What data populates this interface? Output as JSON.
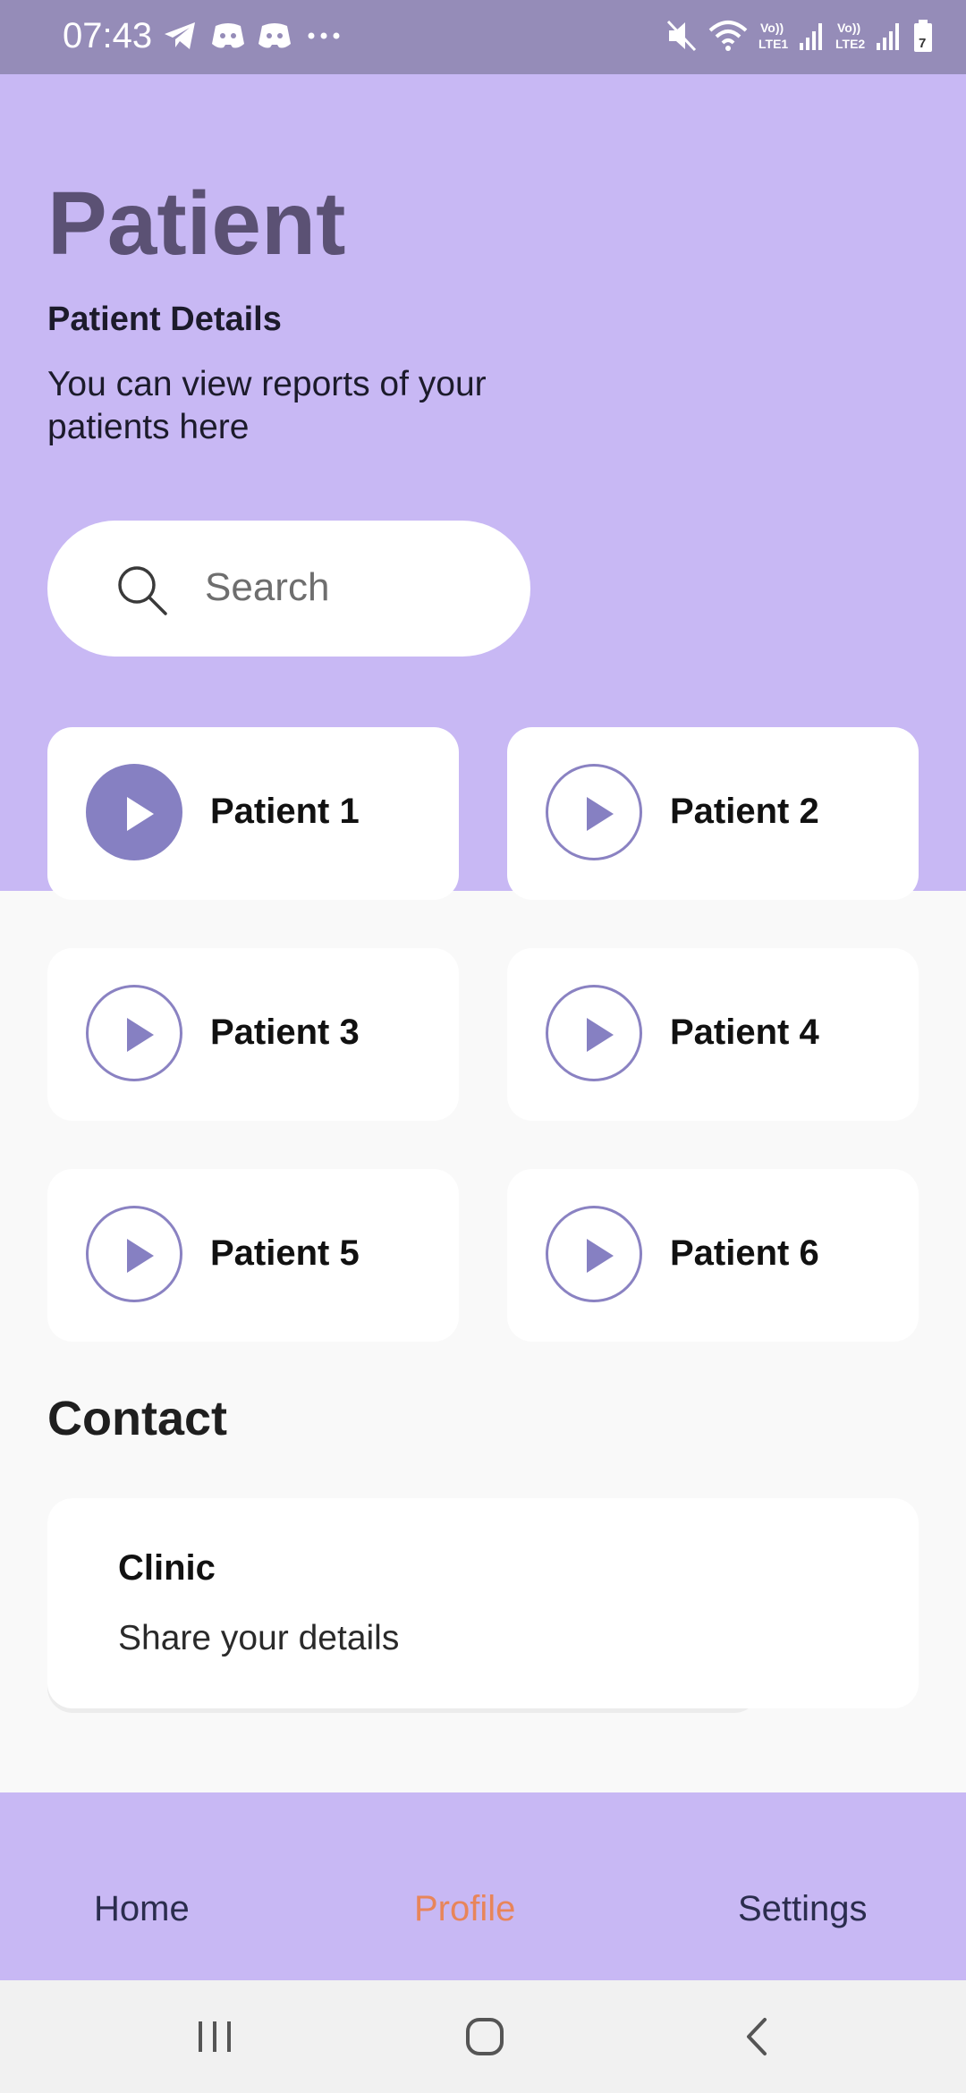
{
  "status_bar": {
    "time": "07:43",
    "left_icons": [
      "telegram-icon",
      "discord-icon",
      "discord-icon",
      "more-dots-icon"
    ],
    "right_icons": [
      "mute-icon",
      "wifi-icon",
      "signal-lte1-icon",
      "signal-lte2-icon",
      "battery-icon"
    ],
    "battery": "7"
  },
  "header": {
    "title": "Patient",
    "subtitle": "Patient Details",
    "description": "You can view reports of your patients here"
  },
  "search": {
    "placeholder": "Search"
  },
  "patients": [
    {
      "label": "Patient 1",
      "active": true
    },
    {
      "label": "Patient 2",
      "active": false
    },
    {
      "label": "Patient 3",
      "active": false
    },
    {
      "label": "Patient 4",
      "active": false
    },
    {
      "label": "Patient 5",
      "active": false
    },
    {
      "label": "Patient 6",
      "active": false
    }
  ],
  "contact": {
    "heading": "Contact",
    "card_title": "Clinic",
    "card_subtitle": "Share your details"
  },
  "bottom_nav": {
    "items": [
      {
        "label": "Home",
        "active": false
      },
      {
        "label": "Profile",
        "active": true
      },
      {
        "label": "Settings",
        "active": false
      }
    ]
  },
  "colors": {
    "header_bg": "#c8b8f4",
    "status_bar_bg": "#958cb8",
    "accent": "#8680c2",
    "active_nav": "#e8855a",
    "title": "#5b5174"
  }
}
